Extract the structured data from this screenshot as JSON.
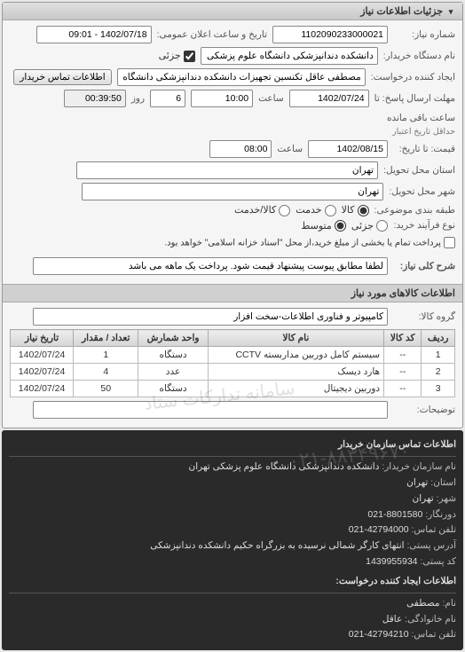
{
  "panel": {
    "title": "جزئیات اطلاعات نیاز",
    "reqNumber_lbl": "شماره نیاز:",
    "reqNumber": "1102090233000021",
    "announceDate_lbl": "تاریخ و ساعت اعلان عمومی:",
    "announceDate": "1402/07/18 - 09:01",
    "buyerDev_lbl": "نام دستگاه خریدار:",
    "buyerDev": "دانشکده دندانپزشکی دانشگاه علوم پزشکی تهران",
    "partial_lbl": "جزئی",
    "creator_lbl": "ایجاد کننده درخواست:",
    "creator": "مصطفی عاقل تکنسین تجهیزات دانشکده دندانپزشکی دانشگاه علوم پزشکی ت",
    "buyerContactBtn": "اطلاعات تماس خریدار",
    "deadlineSend_lbl": "مهلت ارسال پاسخ: تا",
    "deadlineSend_date": "1402/07/24",
    "time_lbl": "ساعت",
    "deadlineSend_time": "10:00",
    "day_lbl": "روز",
    "days_remaining": "6",
    "time_remaining": "00:39:50",
    "remaining_lbl": "ساعت باقی مانده",
    "validityHintTop": "حداقل تاریخ اعتبار",
    "validity_lbl": "قیمت: تا تاریخ:",
    "validity_date": "1402/08/15",
    "validity_time": "08:00",
    "deliveryProv_lbl": "استان محل تحویل:",
    "deliveryProv": "تهران",
    "deliveryCity_lbl": "شهر محل تحویل:",
    "deliveryCity": "تهران",
    "classPkg_lbl": "طبقه بندی موضوعی:",
    "classPkg_opts": {
      "goods": "کالا",
      "service": "خدمت",
      "both": "کالا/خدمت"
    },
    "buyType_lbl": "نوع فرآیند خرید:",
    "buyType_radios": {
      "low": "جزئی",
      "mid": "متوسط"
    },
    "buyType_note": "پرداخت تمام یا بخشی از مبلغ خرید،از محل \"اسناد خزانه اسلامی\" خواهد بود.",
    "desc_lbl": "شرح کلی نیاز:",
    "desc": "لطفا مطابق پیوست پیشنهاد قیمت شود. پرداخت یک ماهه می باشد"
  },
  "goodsSection": {
    "title": "اطلاعات کالاهای مورد نیاز",
    "group_lbl": "گروه کالا:",
    "group": "کامپیوتر و فناوری اطلاعات-سخت افزار",
    "table": {
      "headers": {
        "row": "ردیف",
        "code": "کد کالا",
        "name": "نام کالا",
        "unit": "واحد شمارش",
        "qty": "تعداد / مقدار",
        "date": "تاریخ نیاز"
      },
      "rows": [
        {
          "row": "1",
          "code": "--",
          "name": "سیستم کامل دوربین مداربسته CCTV",
          "unit": "دستگاه",
          "qty": "1",
          "date": "1402/07/24"
        },
        {
          "row": "2",
          "code": "--",
          "name": "هارد دیسک",
          "unit": "عدد",
          "qty": "4",
          "date": "1402/07/24"
        },
        {
          "row": "3",
          "code": "--",
          "name": "دوربین دیجیتال",
          "unit": "دستگاه",
          "qty": "50",
          "date": "1402/07/24"
        }
      ]
    },
    "notes_lbl": "توضیحات:",
    "watermark": "سامانه تدارکات ستاد"
  },
  "contact": {
    "title1": "اطلاعات تماس سازمان خریدار",
    "orgName_lbl": "نام سازمان خریدار:",
    "orgName": "دانشکده دندانپزشکی دانشگاه علوم پزشکی تهران",
    "province_lbl": "استان:",
    "province": "تهران",
    "city_lbl": "شهر:",
    "city": "تهران",
    "fax_lbl": "دورنگار:",
    "fax": "8801580-021",
    "phone_lbl": "تلفن تماس:",
    "phone": "42794000-021",
    "address_lbl": "آدرس پستی:",
    "address": "انتهای کارگر شمالی نرسیده به بزرگراه حکیم دانشکده دندانپزشکی",
    "postal_lbl": "کد پستی:",
    "postal": "1439955934",
    "title2": "اطلاعات ایجاد کننده درخواست:",
    "fname_lbl": "نام:",
    "fname": "مصطفی",
    "lname_lbl": "نام خانوادگی:",
    "lname": "عاقل",
    "cphone_lbl": "تلفن تماس:",
    "cphone": "42794210-021",
    "watermark": "۰۲۱-۸۸۳۴۹۶۷۰"
  }
}
